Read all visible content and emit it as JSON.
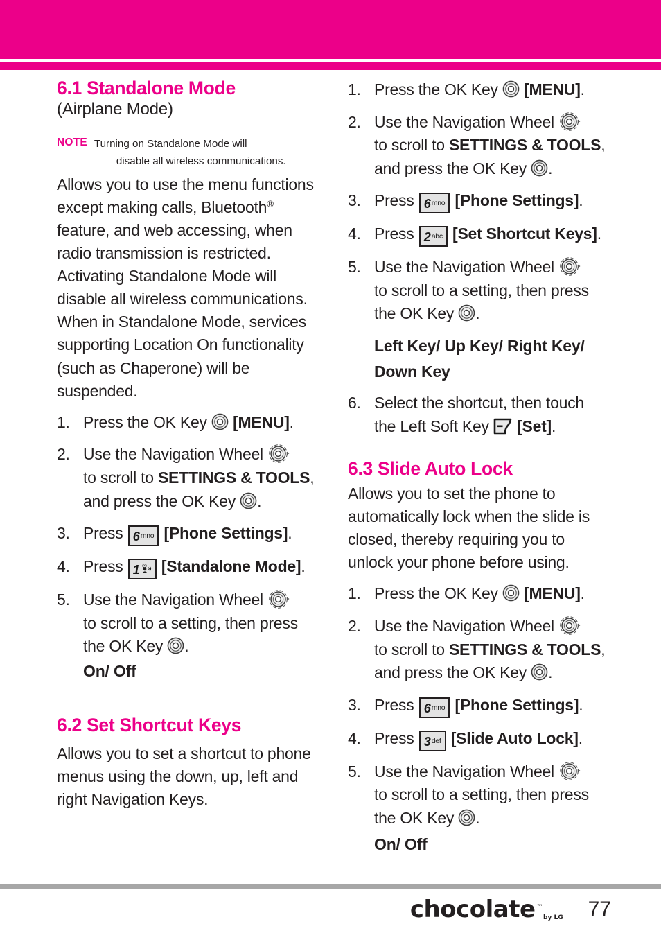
{
  "theme": {
    "accent": "#ec0089",
    "text": "#231f20",
    "rule": "#a7a7a7",
    "key_fill": "#e3e3e3"
  },
  "header": {
    "band_color": "#ec0089"
  },
  "left_column": {
    "section_6_1": {
      "heading": "6.1 Standalone Mode",
      "subtitle": "(Airplane Mode)",
      "note_label": "NOTE",
      "note_line1": "Turning on Standalone Mode will",
      "note_line2": "disable all wireless communications.",
      "body": "Allows you to use the menu functions except making calls, Bluetooth® feature, and web accessing, when radio transmission is restricted. Activating Standalone Mode will disable all wireless communications. When in Standalone Mode, services supporting Location On functionality (such as Chaperone) will be suspended.",
      "steps": [
        {
          "num": "1.",
          "pre": "Press the OK Key",
          "icon": "ok-key",
          "post": "[MENU].",
          "bold_post": "[MENU]"
        },
        {
          "num": "2.",
          "pre": "Use the Navigation Wheel",
          "icon": "nav-wheel",
          "line2a": "to scroll to ",
          "bold": "SETTINGS & TOOLS",
          "line2b": ",",
          "line3": "and press the OK Key",
          "icon2": "ok-key",
          "tail": "."
        },
        {
          "num": "3.",
          "pre": "Press",
          "key": {
            "digit": "6",
            "letters": "mno"
          },
          "bold_post": "[Phone Settings]",
          "tail": "."
        },
        {
          "num": "4.",
          "pre": "Press",
          "key": {
            "digit": "1",
            "letters": "voicemail"
          },
          "bold_post": "[Standalone Mode]",
          "tail": "."
        },
        {
          "num": "5.",
          "pre": "Use the Navigation Wheel",
          "icon": "nav-wheel",
          "line2": "to scroll to a setting, then press",
          "line3": "the OK Key",
          "icon2": "ok-key",
          "tail": ".",
          "sublabel": "On/ Off"
        }
      ]
    },
    "section_6_2": {
      "heading": "6.2 Set Shortcut Keys",
      "body": "Allows you to set a shortcut to phone menus using the down, up, left and right Navigation Keys."
    }
  },
  "right_column": {
    "section_6_2_steps": [
      {
        "num": "1.",
        "pre": "Press the OK Key",
        "icon": "ok-key",
        "bold_post": "[MENU]",
        "tail": "."
      },
      {
        "num": "2.",
        "pre": "Use the Navigation Wheel",
        "icon": "nav-wheel",
        "line2a": "to scroll to ",
        "bold": "SETTINGS & TOOLS",
        "line2b": ",",
        "line3": "and press the OK Key",
        "icon2": "ok-key",
        "tail": "."
      },
      {
        "num": "3.",
        "pre": "Press",
        "key": {
          "digit": "6",
          "letters": "mno"
        },
        "bold_post": "[Phone Settings]",
        "tail": "."
      },
      {
        "num": "4.",
        "pre": "Press",
        "key": {
          "digit": "2",
          "letters": "abc"
        },
        "bold_post": "[Set Shortcut Keys]",
        "tail": "."
      },
      {
        "num": "5.",
        "pre": "Use the Navigation Wheel",
        "icon": "nav-wheel",
        "line2": "to scroll to a setting, then press",
        "line3": "the OK Key",
        "icon2": "ok-key",
        "tail": ".",
        "sublabel_l1": "Left Key/ Up Key/ Right Key/",
        "sublabel_l2": "Down Key"
      },
      {
        "num": "6.",
        "pre": "Select the shortcut, then touch",
        "line2": "the Left Soft Key",
        "icon": "soft-key",
        "bold_post": "[Set]",
        "tail": "."
      }
    ],
    "section_6_3": {
      "heading": "6.3 Slide Auto Lock",
      "body": "Allows you to set the phone to automatically lock when the slide is closed, thereby requiring you to unlock your phone before using.",
      "steps": [
        {
          "num": "1.",
          "pre": "Press the OK Key",
          "icon": "ok-key",
          "bold_post": "[MENU]",
          "tail": "."
        },
        {
          "num": "2.",
          "pre": "Use the Navigation Wheel",
          "icon": "nav-wheel",
          "line2a": "to scroll to ",
          "bold": "SETTINGS & TOOLS",
          "line2b": ",",
          "line3": "and press the OK Key",
          "icon2": "ok-key",
          "tail": "."
        },
        {
          "num": "3.",
          "pre": "Press",
          "key": {
            "digit": "6",
            "letters": "mno"
          },
          "bold_post": "[Phone Settings]",
          "tail": "."
        },
        {
          "num": "4.",
          "pre": "Press",
          "key": {
            "digit": "3",
            "letters": "def"
          },
          "bold_post": "[Slide Auto Lock]",
          "tail": "."
        },
        {
          "num": "5.",
          "pre": "Use the Navigation Wheel",
          "icon": "nav-wheel",
          "line2": "to scroll to a setting, then press",
          "line3": "the OK Key",
          "icon2": "ok-key",
          "tail": ".",
          "sublabel": "On/ Off"
        }
      ]
    }
  },
  "footer": {
    "logo_text": "chocolate",
    "logo_tm": "™",
    "logo_by": "by LG",
    "page_number": "77"
  }
}
